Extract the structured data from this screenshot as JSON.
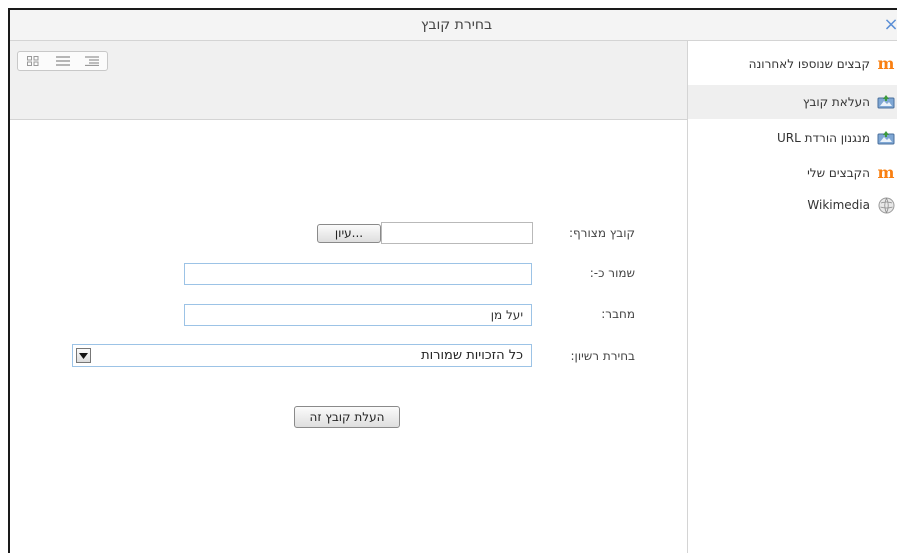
{
  "dialog": {
    "title": "בחירת קובץ",
    "close": "×"
  },
  "sidebar": {
    "items": [
      {
        "label": "קבצים שנוספו לאחרונה",
        "icon": "moodle-icon"
      },
      {
        "label": "העלאת קובץ",
        "icon": "upload-icon",
        "active": true
      },
      {
        "label": "מנגנון הורדת URL",
        "icon": "url-download-icon"
      },
      {
        "label": "הקבצים שלי",
        "icon": "moodle-icon"
      },
      {
        "label": "Wikimedia",
        "icon": "wikimedia-icon"
      }
    ]
  },
  "toolbar": {
    "views": [
      "icons-view",
      "list-view",
      "tree-view"
    ]
  },
  "form": {
    "attachment_label": "קובץ מצורף:",
    "browse_label": "עיון...",
    "save_as_label": "שמור כ-:",
    "save_as_value": "",
    "author_label": "מחבר:",
    "author_value": "יעל מן",
    "license_label": "בחירת רשיון:",
    "license_value": "כל הזכויות שמורות",
    "upload_label": "העלת קובץ זה"
  },
  "colors": {
    "accent": "#5b8fd6",
    "moodle": "#f98012",
    "input_border": "#9cc3e6"
  }
}
